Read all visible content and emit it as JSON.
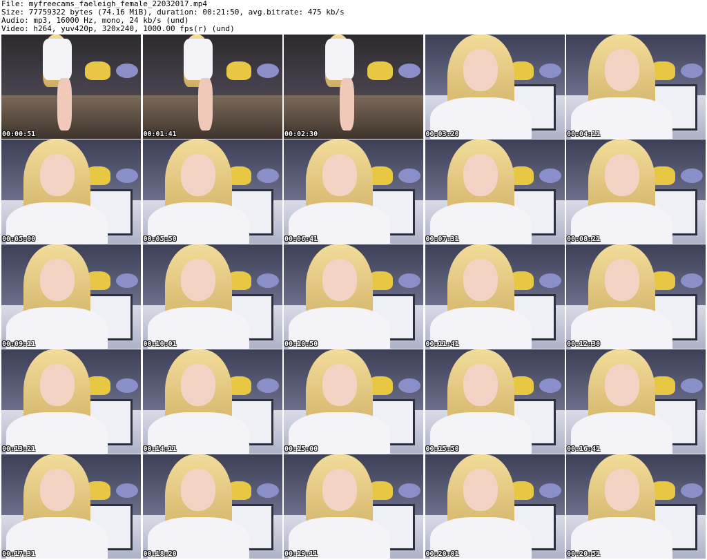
{
  "header": {
    "file_line": "File: myfreecams_faeleigh_female_22032017.mp4",
    "size_line": "Size: 77759322 bytes (74.16 MiB), duration: 00:21:50, avg.bitrate: 475 kb/s",
    "audio_line": "Audio: mp3, 16000 Hz, mono, 24 kb/s (und)",
    "video_line": "Video: h264, yuv420p, 320x240, 1000.00 fps(r) (und)"
  },
  "thumbnails": [
    {
      "time": "00:00:51",
      "variant": "a"
    },
    {
      "time": "00:01:41",
      "variant": "a"
    },
    {
      "time": "00:02:30",
      "variant": "a"
    },
    {
      "time": "00:03:20",
      "variant": "b"
    },
    {
      "time": "00:04:11",
      "variant": "b"
    },
    {
      "time": "00:05:00",
      "variant": "b"
    },
    {
      "time": "00:05:50",
      "variant": "b"
    },
    {
      "time": "00:06:41",
      "variant": "b"
    },
    {
      "time": "00:07:31",
      "variant": "b"
    },
    {
      "time": "00:08:21",
      "variant": "b"
    },
    {
      "time": "00:09:11",
      "variant": "b"
    },
    {
      "time": "00:10:01",
      "variant": "b"
    },
    {
      "time": "00:10:50",
      "variant": "b"
    },
    {
      "time": "00:11:41",
      "variant": "b"
    },
    {
      "time": "00:12:30",
      "variant": "b"
    },
    {
      "time": "00:13:21",
      "variant": "b"
    },
    {
      "time": "00:14:11",
      "variant": "b"
    },
    {
      "time": "00:15:00",
      "variant": "b"
    },
    {
      "time": "00:15:50",
      "variant": "b"
    },
    {
      "time": "00:16:41",
      "variant": "b"
    },
    {
      "time": "00:17:31",
      "variant": "b"
    },
    {
      "time": "00:18:20",
      "variant": "b"
    },
    {
      "time": "00:19:11",
      "variant": "b"
    },
    {
      "time": "00:20:01",
      "variant": "b"
    },
    {
      "time": "00:20:51",
      "variant": "b"
    }
  ]
}
